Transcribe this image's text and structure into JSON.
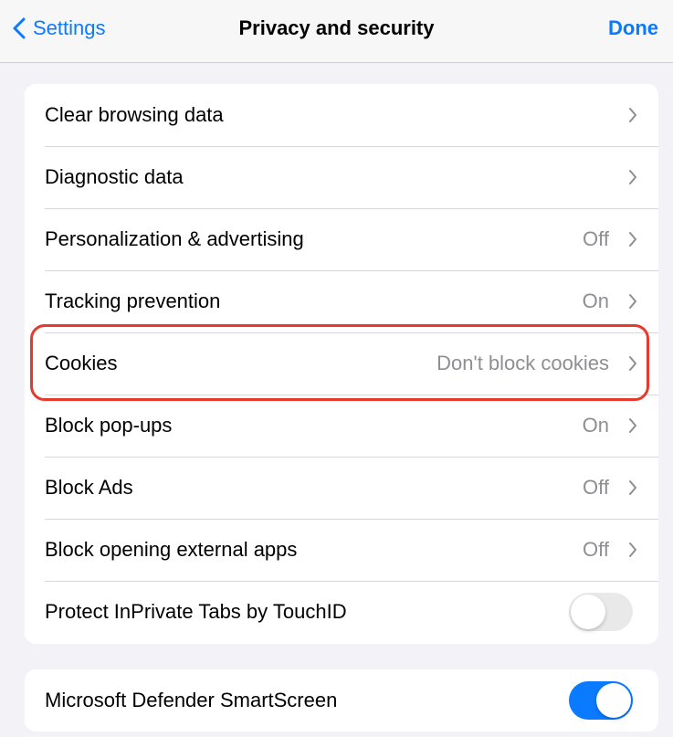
{
  "navbar": {
    "back_label": "Settings",
    "title": "Privacy and security",
    "done_label": "Done"
  },
  "group1": {
    "rows": [
      {
        "label": "Clear browsing data",
        "value": ""
      },
      {
        "label": "Diagnostic data",
        "value": ""
      },
      {
        "label": "Personalization & advertising",
        "value": "Off"
      },
      {
        "label": "Tracking prevention",
        "value": "On"
      },
      {
        "label": "Cookies",
        "value": "Don't block cookies"
      },
      {
        "label": "Block pop-ups",
        "value": "On"
      },
      {
        "label": "Block Ads",
        "value": "Off"
      },
      {
        "label": "Block opening external apps",
        "value": "Off"
      },
      {
        "label": "Protect InPrivate Tabs by TouchID",
        "toggle": false
      }
    ]
  },
  "group2": {
    "rows": [
      {
        "label": "Microsoft Defender SmartScreen",
        "toggle": true
      }
    ]
  },
  "colors": {
    "accent": "#0a7aff",
    "highlight": "#e8392f",
    "background": "#f2f2f7"
  },
  "icons": {
    "back": "chevron-left-icon",
    "disclosure": "chevron-right-icon"
  }
}
